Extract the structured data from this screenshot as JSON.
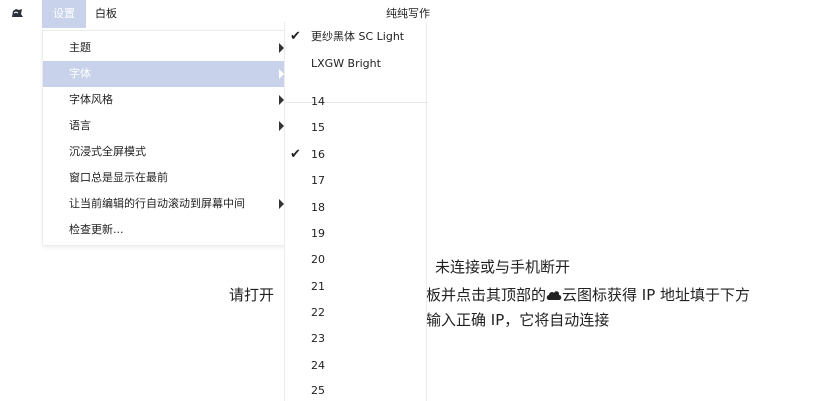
{
  "app": {
    "title": "纯纯写作",
    "logo_icon": "app-logo-icon"
  },
  "menubar": [
    {
      "label": "设置",
      "active": true
    },
    {
      "label": "白板",
      "active": false
    }
  ],
  "settings_menu": {
    "items": [
      {
        "label": "主题",
        "submenu": true,
        "highlighted": false
      },
      {
        "label": "字体",
        "submenu": true,
        "highlighted": true
      },
      {
        "label": "字体风格",
        "submenu": true,
        "highlighted": false
      },
      {
        "label": "语言",
        "submenu": true,
        "highlighted": false
      },
      {
        "label": "沉浸式全屏模式",
        "submenu": false,
        "highlighted": false
      },
      {
        "label": "窗口总是显示在最前",
        "submenu": false,
        "highlighted": false
      },
      {
        "label": "让当前编辑的行自动滚动到屏幕中间",
        "submenu": true,
        "highlighted": false
      },
      {
        "label": "检查更新...",
        "submenu": false,
        "highlighted": false
      }
    ]
  },
  "font_submenu": {
    "fonts": [
      {
        "label": "更纱黑体 SC Light",
        "checked": true
      },
      {
        "label": "LXGW Bright",
        "checked": false
      }
    ],
    "sizes": [
      {
        "label": "14",
        "checked": false
      },
      {
        "label": "15",
        "checked": false
      },
      {
        "label": "16",
        "checked": true
      },
      {
        "label": "17",
        "checked": false
      },
      {
        "label": "18",
        "checked": false
      },
      {
        "label": "19",
        "checked": false
      },
      {
        "label": "20",
        "checked": false
      },
      {
        "label": "21",
        "checked": false
      },
      {
        "label": "22",
        "checked": false
      },
      {
        "label": "23",
        "checked": false
      },
      {
        "label": "24",
        "checked": false
      },
      {
        "label": "25",
        "checked": false
      }
    ],
    "check_glyph": "✔"
  },
  "message": {
    "status": "未连接或与手机断开",
    "line1_left": "请打开",
    "line1_right_a": "板并点击其顶部的",
    "cloud_icon": "cloud-icon",
    "line1_right_b": "云图标获得 IP 地址填于下方",
    "line2_right": "输入正确 IP，它将自动连接"
  }
}
